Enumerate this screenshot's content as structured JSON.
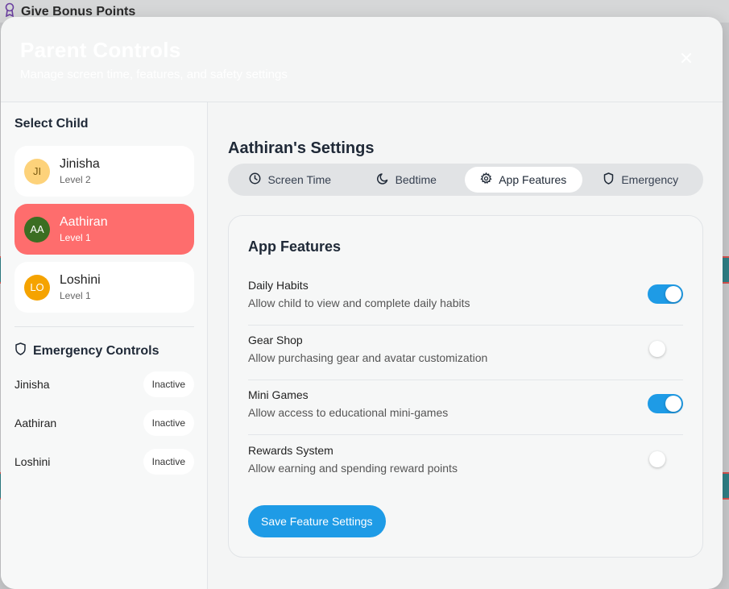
{
  "background": {
    "title": "Give Bonus Points",
    "icon": "award-icon"
  },
  "modal": {
    "title": "Parent Controls",
    "subtitle": "Manage screen time, features, and safety settings",
    "close_icon": "close-icon"
  },
  "sidebar": {
    "heading": "Select Child",
    "children": [
      {
        "initials": "JI",
        "name": "Jinisha",
        "level": "Level 2",
        "avatar_color": "#fdd27a",
        "avatar_text_color": "#7a5a10"
      },
      {
        "initials": "AA",
        "name": "Aathiran",
        "level": "Level 1",
        "avatar_color": "#3b6e22",
        "avatar_text_color": "#ffffff",
        "selected": true
      },
      {
        "initials": "LO",
        "name": "Loshini",
        "level": "Level 1",
        "avatar_color": "#f5a300",
        "avatar_text_color": "#ffffff"
      }
    ],
    "emergency_heading": "Emergency Controls",
    "emergency": [
      {
        "name": "Jinisha",
        "status": "Inactive"
      },
      {
        "name": "Aathiran",
        "status": "Inactive"
      },
      {
        "name": "Loshini",
        "status": "Inactive"
      }
    ]
  },
  "main": {
    "title": "Aathiran's Settings",
    "tabs": [
      {
        "label": "Screen Time",
        "icon": "clock-icon"
      },
      {
        "label": "Bedtime",
        "icon": "moon-icon"
      },
      {
        "label": "App Features",
        "icon": "gear-icon",
        "active": true
      },
      {
        "label": "Emergency",
        "icon": "shield-icon"
      }
    ],
    "panel": {
      "title": "App Features",
      "features": [
        {
          "name": "Daily Habits",
          "description": "Allow child to view and complete daily habits",
          "enabled": true
        },
        {
          "name": "Gear Shop",
          "description": "Allow purchasing gear and avatar customization",
          "enabled": false
        },
        {
          "name": "Mini Games",
          "description": "Allow access to educational mini-games",
          "enabled": true
        },
        {
          "name": "Rewards System",
          "description": "Allow earning and spending reward points",
          "enabled": false
        }
      ],
      "save_label": "Save Feature Settings"
    }
  },
  "colors": {
    "accent": "#1e9be6",
    "selected_child": "#fe6d6d"
  }
}
